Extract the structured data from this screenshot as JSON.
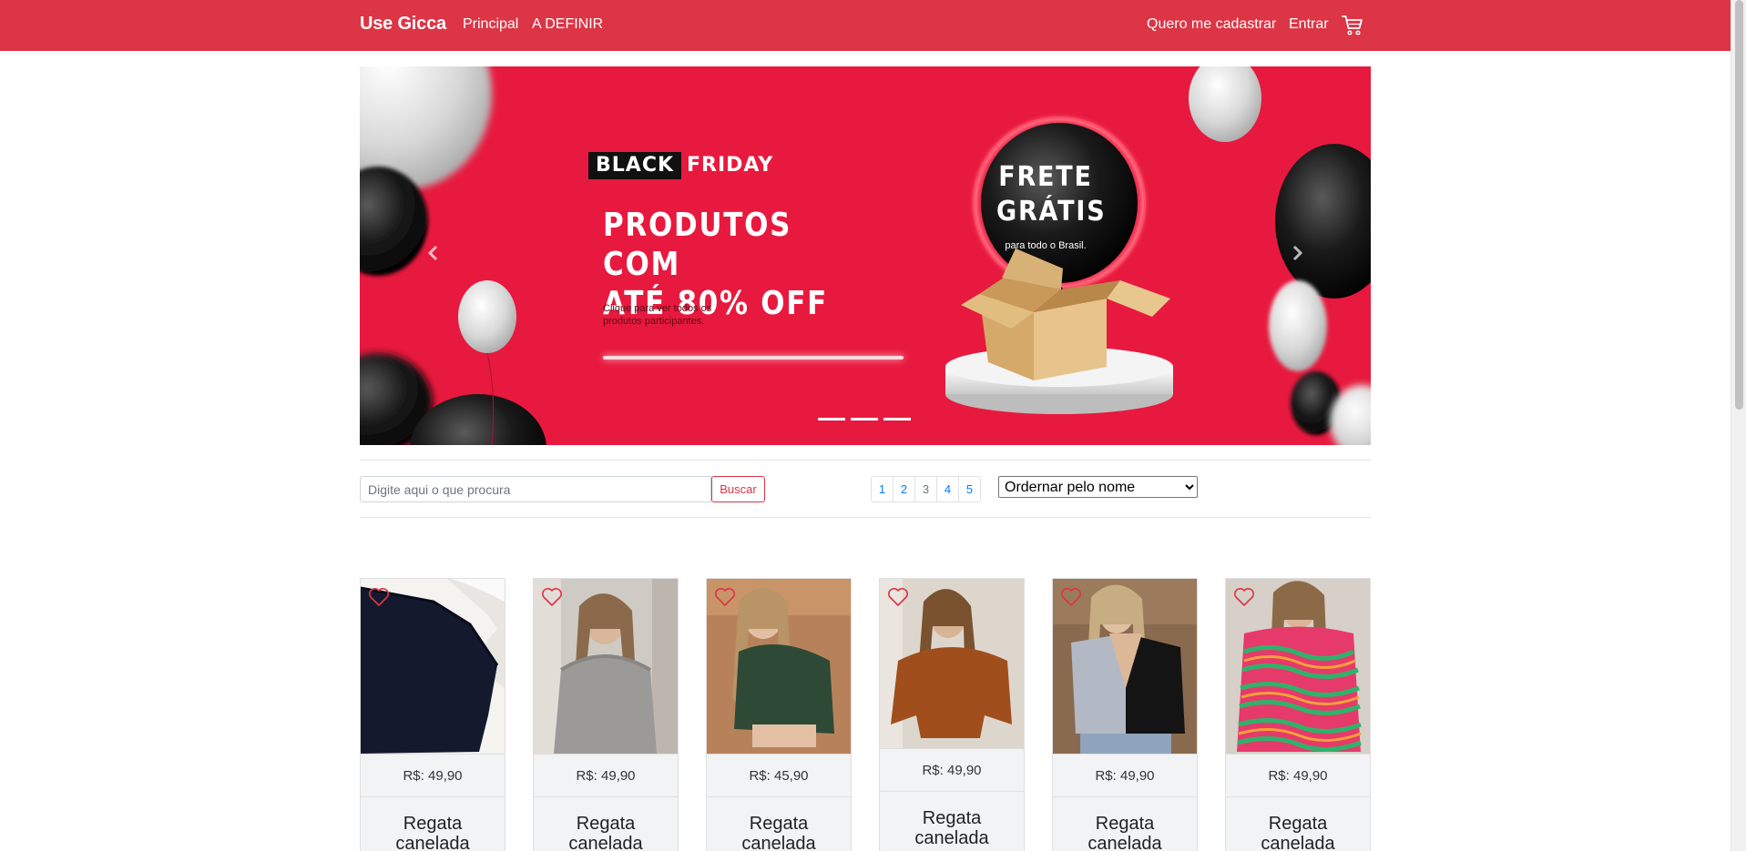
{
  "navbar": {
    "brand": "Use Gicca",
    "links": [
      "Principal",
      "A DEFINIR"
    ],
    "register": "Quero me cadastrar",
    "login": "Entrar",
    "cart_icon": "cart-icon",
    "bg_color": "#dc3545"
  },
  "banner": {
    "tag_black": "BLACK",
    "tag_friday": "FRIDAY",
    "headline_line1": "PRODUTOS COM",
    "headline_line2": "ATÉ 80% OFF",
    "subtext_line1": "Clique para ver todos os",
    "subtext_line2": "produtos participantes.",
    "balloon_line1": "FRETE",
    "balloon_line2": "GRÁTIS",
    "balloon_sub": "para todo o Brasil.",
    "bg_color": "#e8193e",
    "indicator_count": 3
  },
  "search": {
    "placeholder": "Digite aqui o que procura",
    "value": "",
    "button": "Buscar"
  },
  "pagination": {
    "pages": [
      "1",
      "2",
      "3",
      "4",
      "5"
    ],
    "active": "3"
  },
  "sort": {
    "selected": "Ordernar pelo nome"
  },
  "products": [
    {
      "price": "R$: 49,90",
      "name_line1": "Regata",
      "name_line2": "canelada",
      "favorite": false
    },
    {
      "price": "R$: 49,90",
      "name_line1": "Regata",
      "name_line2": "canelada",
      "favorite": false
    },
    {
      "price": "R$: 45,90",
      "name_line1": "Regata",
      "name_line2": "canelada",
      "favorite": false
    },
    {
      "price": "R$: 49,90",
      "name_line1": "Regata",
      "name_line2": "canelada",
      "favorite": false
    },
    {
      "price": "R$: 49,90",
      "name_line1": "Regata",
      "name_line2": "canelada",
      "favorite": false
    },
    {
      "price": "R$: 49,90",
      "name_line1": "Regata",
      "name_line2": "canelada",
      "favorite": false
    }
  ]
}
